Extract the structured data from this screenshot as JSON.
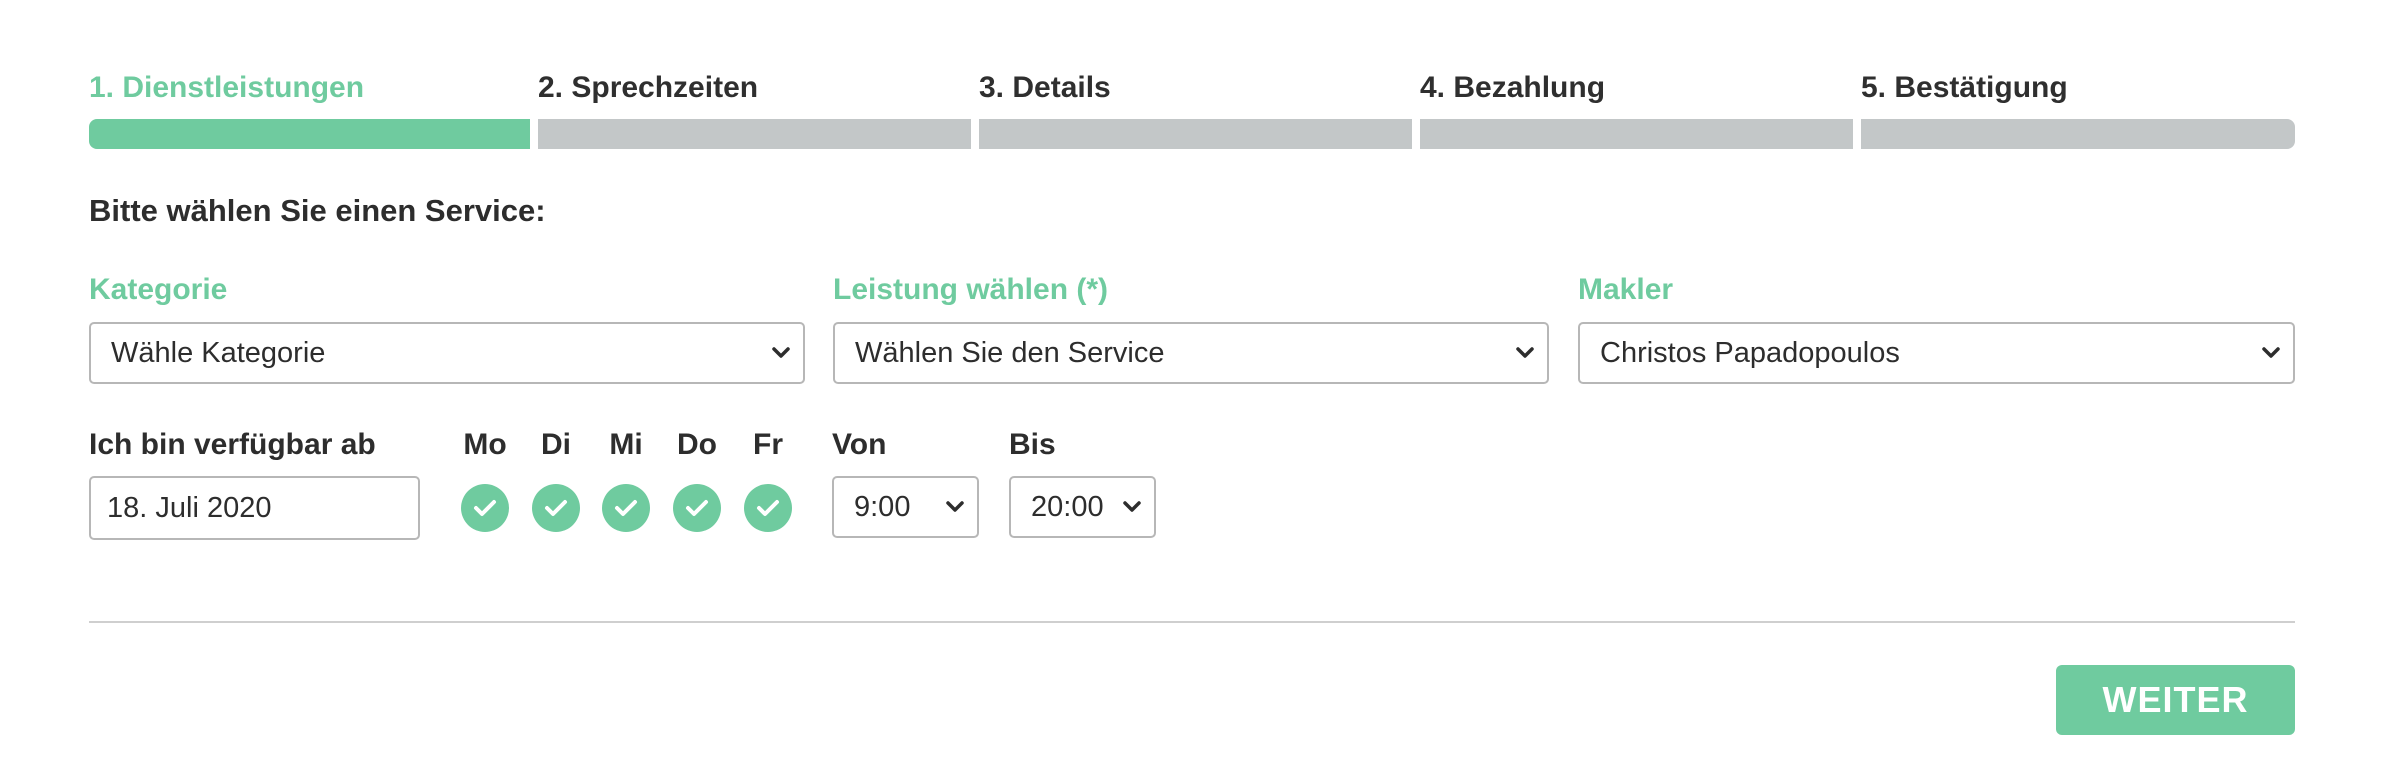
{
  "steps": [
    {
      "label": "1. Dienstleistungen",
      "active": true
    },
    {
      "label": "2. Sprechzeiten",
      "active": false
    },
    {
      "label": "3. Details",
      "active": false
    },
    {
      "label": "4. Bezahlung",
      "active": false
    },
    {
      "label": "5. Bestätigung",
      "active": false
    }
  ],
  "heading": "Bitte wählen Sie einen Service:",
  "fields": {
    "category": {
      "label": "Kategorie",
      "value": "Wähle Kategorie"
    },
    "service": {
      "label": "Leistung wählen (*)",
      "value": "Wählen Sie den Service"
    },
    "agent": {
      "label": "Makler",
      "value": "Christos Papadopoulos"
    }
  },
  "availability": {
    "label": "Ich bin verfügbar ab",
    "date": "18. Juli 2020",
    "days": [
      {
        "label": "Mo",
        "checked": true
      },
      {
        "label": "Di",
        "checked": true
      },
      {
        "label": "Mi",
        "checked": true
      },
      {
        "label": "Do",
        "checked": true
      },
      {
        "label": "Fr",
        "checked": true
      }
    ],
    "from": {
      "label": "Von",
      "value": "9:00"
    },
    "to": {
      "label": "Bis",
      "value": "20:00"
    }
  },
  "next_button": "WEITER",
  "colors": {
    "accent": "#6fcb9f",
    "inactive_bar": "#c3c7c8",
    "text": "#2d2d2d"
  },
  "icons": {
    "checkmark": "check-icon",
    "dropdown": "chevron-down-icon"
  }
}
